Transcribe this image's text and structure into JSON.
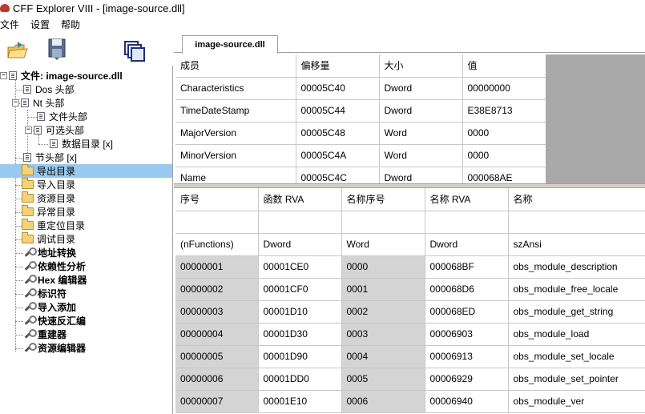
{
  "window": {
    "title": "CFF Explorer VIII - [image-source.dll]"
  },
  "menu": [
    "文件",
    "设置",
    "帮助"
  ],
  "toolbar": {
    "icons": [
      "open-folder-icon",
      "save-disk-icon",
      "windows-icon"
    ]
  },
  "tab": {
    "label": "image-source.dll"
  },
  "tree": {
    "root": "文件: image-source.dll",
    "dos": "Dos 头部",
    "nt": "Nt 头部",
    "file_header": "文件头部",
    "optional_header": "可选头部",
    "data_dir": "数据目录 [x]",
    "section_header": "节头部 [x]",
    "export_dir": "导出目录",
    "import_dir": "导入目录",
    "resource_dir": "资源目录",
    "exception_dir": "异常目录",
    "reloc_dir": "重定位目录",
    "debug_dir": "调试目录",
    "address_converter": "地址转换",
    "dependency_walker": "依赖性分析",
    "hex_editor": "Hex 编辑器",
    "identifier": "标识符",
    "import_adder": "导入添加",
    "quick_disasm": "快速反汇编",
    "rebuilder": "重建器",
    "resource_editor": "资源编辑器"
  },
  "upper_table": {
    "headers": [
      "成员",
      "偏移量",
      "大小",
      "值"
    ],
    "rows": [
      [
        "Characteristics",
        "00005C40",
        "Dword",
        "00000000"
      ],
      [
        "TimeDateStamp",
        "00005C44",
        "Dword",
        "E38E8713"
      ],
      [
        "MajorVersion",
        "00005C48",
        "Word",
        "0000"
      ],
      [
        "MinorVersion",
        "00005C4A",
        "Word",
        "0000"
      ],
      [
        "Name",
        "00005C4C",
        "Dword",
        "000068AE"
      ]
    ]
  },
  "lower_table": {
    "headers": [
      "序号",
      "函数 RVA",
      "名称序号",
      "名称 RVA",
      "名称"
    ],
    "subheaders": [
      "(nFunctions)",
      "Dword",
      "Word",
      "Dword",
      "szAnsi"
    ],
    "rows": [
      [
        "00000001",
        "00001CE0",
        "0000",
        "000068BF",
        "obs_module_description"
      ],
      [
        "00000002",
        "00001CF0",
        "0001",
        "000068D6",
        "obs_module_free_locale"
      ],
      [
        "00000003",
        "00001D10",
        "0002",
        "000068ED",
        "obs_module_get_string"
      ],
      [
        "00000004",
        "00001D30",
        "0003",
        "00006903",
        "obs_module_load"
      ],
      [
        "00000005",
        "00001D90",
        "0004",
        "00006913",
        "obs_module_set_locale"
      ],
      [
        "00000006",
        "00001DD0",
        "0005",
        "00006929",
        "obs_module_set_pointer"
      ],
      [
        "00000007",
        "00001E10",
        "0006",
        "00006940",
        "obs_module_ver"
      ]
    ]
  }
}
